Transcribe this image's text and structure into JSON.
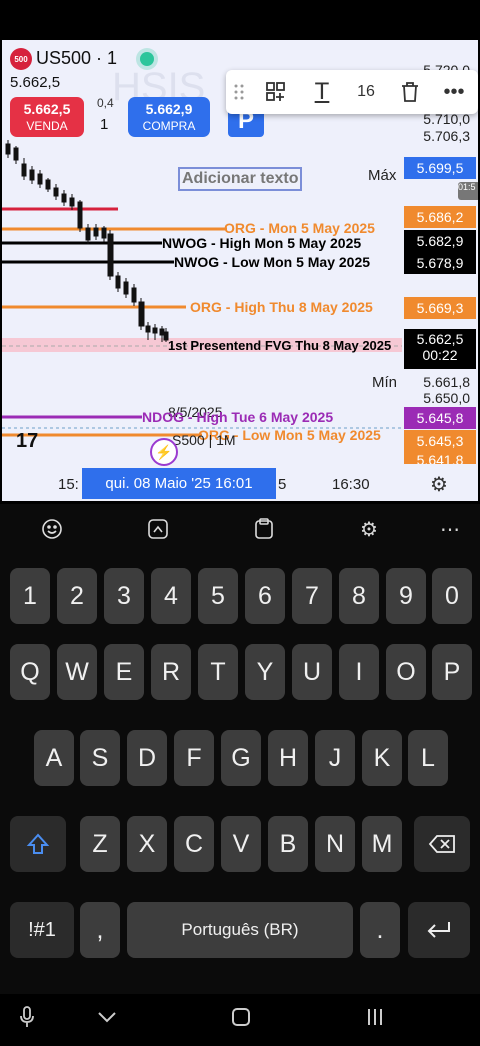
{
  "chart": {
    "symbol": "US500 · 1",
    "logo_badge": "500",
    "last_price": "5.662,5",
    "sell": {
      "price": "5.662,5",
      "label": "VENDA"
    },
    "buy": {
      "price": "5.662,9",
      "label": "COMPRA"
    },
    "spread": "0,4",
    "quantity": "1",
    "toolbar": {
      "font_size": "16"
    },
    "add_text_placeholder": "Adicionar texto",
    "max_label": "Máx",
    "min_label": "Mín",
    "right_axis": {
      "top1": "5.720,0",
      "top2": "5.710,0",
      "max_value": "5.706,3",
      "min_value": "5.661,8",
      "low1": "5.650,0",
      "low2": "5.641,8"
    },
    "price_tags": [
      {
        "value": "5.699,5",
        "color": "#2f6fec"
      },
      {
        "value": "5.686,2",
        "color": "#f08a2e"
      },
      {
        "value": "5.682,9",
        "color": "#000000"
      },
      {
        "value": "5.678,9",
        "color": "#000000"
      },
      {
        "value": "5.669,3",
        "color": "#f08a2e"
      },
      {
        "value": "5.645,8",
        "color": "#9b2bb5"
      },
      {
        "value": "5.645,3",
        "color": "#f08a2e"
      }
    ],
    "current_tag": {
      "price": "5.662,5",
      "countdown": "00:22"
    },
    "lines": [
      {
        "label": "ORG - Mon 5 May 2025",
        "color": "#f08a2e"
      },
      {
        "label": "NWOG  - High  Mon 5 May 2025",
        "color": "#000000"
      },
      {
        "label": "NWOG - Low Mon 5 May 2025",
        "color": "#000000"
      },
      {
        "label": "ORG - High Thu 8 May 2025",
        "color": "#f08a2e"
      },
      {
        "label": "1st Presentend FVG Thu 8 May 2025",
        "color": "#000000"
      },
      {
        "label": "NDOG - High Tue 6 May 2025",
        "color": "#9b2bb5"
      },
      {
        "label": "ORG - Low Mon 5 May 2025",
        "color": "#f08a2e"
      }
    ],
    "overlay_texts": {
      "date_small": "8/5/2025",
      "symbol_small": "S500 | 1M"
    },
    "x_axis": {
      "left": "15:",
      "right_partial": "5",
      "time": "16:30",
      "crosshair_date": "qui. 08 Maio '25   16:01"
    },
    "side_time": "01:5",
    "tv_logo": "17",
    "colors": {
      "accent": "#2f6fec",
      "sell": "#e53145",
      "org": "#f08a2e",
      "ndog": "#9b2bb5"
    }
  },
  "keyboard": {
    "toolbar_icons": [
      "emoji-icon",
      "sticker-icon",
      "clipboard-icon",
      "settings-icon",
      "more-icon"
    ],
    "row_numbers": [
      "1",
      "2",
      "3",
      "4",
      "5",
      "6",
      "7",
      "8",
      "9",
      "0"
    ],
    "row_q": [
      "Q",
      "W",
      "E",
      "R",
      "T",
      "Y",
      "U",
      "I",
      "O",
      "P"
    ],
    "row_a": [
      "A",
      "S",
      "D",
      "F",
      "G",
      "H",
      "J",
      "K",
      "L"
    ],
    "row_z": [
      "Z",
      "X",
      "C",
      "V",
      "B",
      "N",
      "M"
    ],
    "symbols_key": "!#1",
    "comma_key": ",",
    "space_label": "Português (BR)",
    "period_key": "."
  }
}
